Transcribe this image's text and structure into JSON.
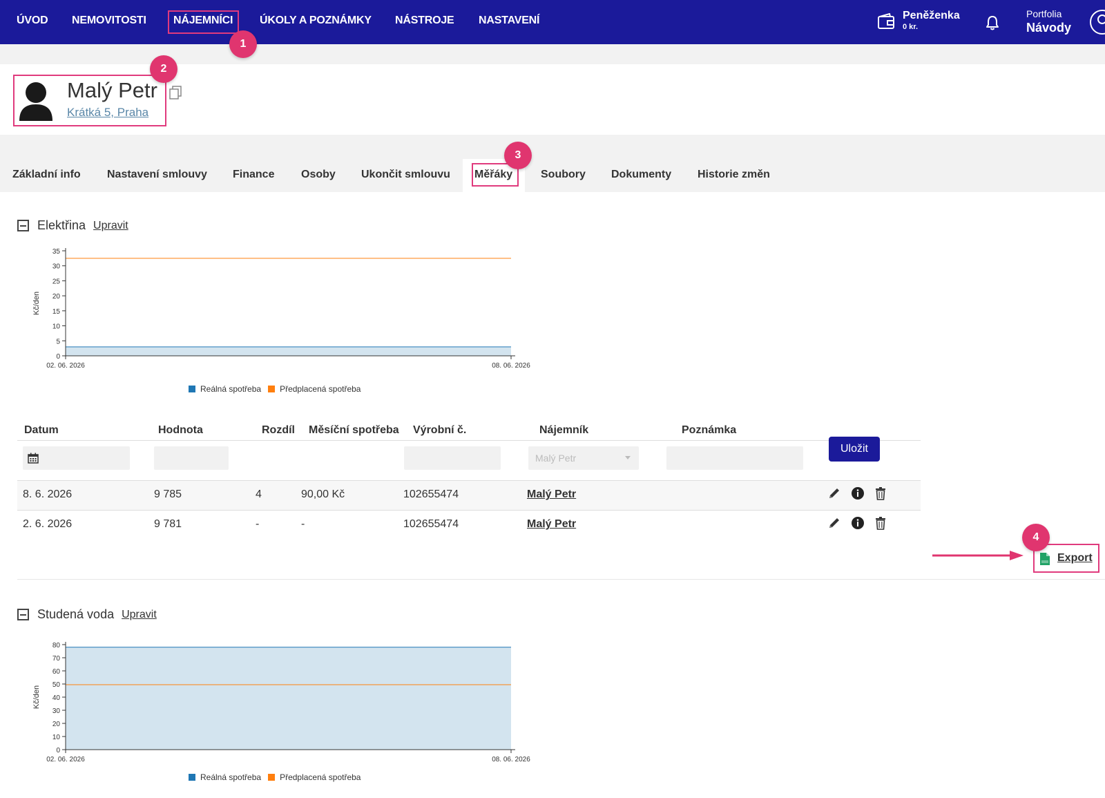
{
  "nav": {
    "items": [
      "ÚVOD",
      "NEMOVITOSTI",
      "NÁJEMNÍCI",
      "ÚKOLY A POZNÁMKY",
      "NÁSTROJE",
      "NASTAVENÍ"
    ],
    "active": "NÁJEMNÍCI",
    "wallet": {
      "title": "Peněženka",
      "subtitle": "0 kr."
    },
    "portfolio": {
      "label": "Portfolia",
      "value": "Návody"
    }
  },
  "tenant": {
    "name": "Malý Petr",
    "address": "Krátká 5, Praha"
  },
  "tabs": [
    "Základní info",
    "Nastavení smlouvy",
    "Finance",
    "Osoby",
    "Ukončit smlouvu",
    "Měřáky",
    "Soubory",
    "Dokumenty",
    "Historie změn"
  ],
  "active_tab": "Měřáky",
  "badges": [
    "1",
    "2",
    "3",
    "4"
  ],
  "sections": [
    {
      "title": "Elektřina",
      "edit": "Upravit"
    },
    {
      "title": "Studená voda",
      "edit": "Upravit"
    }
  ],
  "table": {
    "headers": [
      "Datum",
      "Hodnota",
      "Rozdíl",
      "Měsíční spotřeba",
      "Výrobní č.",
      "Nájemník",
      "Poznámka"
    ],
    "tenant_select": "Malý Petr",
    "save_label": "Uložit",
    "rows": [
      {
        "date": "8. 6. 2026",
        "value": "9 785",
        "diff": "4",
        "monthly": "90,00 Kč",
        "serial": "102655474",
        "tenant": "Malý Petr"
      },
      {
        "date": "2. 6. 2026",
        "value": "9 781",
        "diff": "-",
        "monthly": "-",
        "serial": "102655474",
        "tenant": "Malý Petr"
      }
    ]
  },
  "export_label": "Export",
  "colors": {
    "nav_bg": "#1b1a9a",
    "highlight": "#e03a7d",
    "badge": "#e0356f",
    "real": "#1f77b4",
    "prepaid": "#ff7f0e",
    "area_fill": "#d3e4ef"
  },
  "chart_data": [
    {
      "type": "area",
      "ylabel": "Kč/den",
      "x": [
        "02. 06. 2026",
        "08. 06. 2026"
      ],
      "ylim": [
        0,
        35
      ],
      "yticks": [
        0,
        5,
        10,
        15,
        20,
        25,
        30,
        35
      ],
      "series": [
        {
          "name": "Reálná spotřeba",
          "values": [
            3,
            3
          ]
        },
        {
          "name": "Předplacená spotřeba",
          "values": [
            32.5,
            32.5
          ]
        }
      ],
      "legend": "bottom"
    },
    {
      "type": "area",
      "ylabel": "Kč/den",
      "x": [
        "02. 06. 2026",
        "08. 06. 2026"
      ],
      "ylim": [
        0,
        80
      ],
      "yticks": [
        0,
        10,
        20,
        30,
        40,
        50,
        60,
        70,
        80
      ],
      "series": [
        {
          "name": "Reálná spotřeba",
          "values": [
            78,
            78
          ]
        },
        {
          "name": "Předplacená spotřeba",
          "values": [
            49.5,
            49.5
          ]
        }
      ],
      "legend": "bottom"
    }
  ]
}
